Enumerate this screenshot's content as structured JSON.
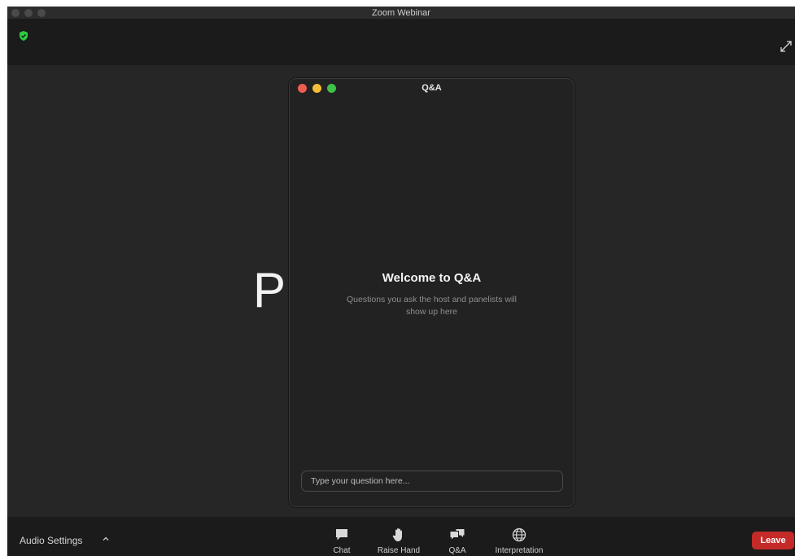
{
  "window": {
    "title": "Zoom Webinar"
  },
  "stage": {
    "presenter_text": "Pa"
  },
  "qa": {
    "title": "Q&A",
    "welcome": "Welcome to Q&A",
    "subtitle": "Questions you ask the host and panelists will show up here",
    "input": {
      "value": "",
      "placeholder": "Type your question here..."
    }
  },
  "toolbar": {
    "audio_settings": "Audio Settings",
    "buttons": {
      "chat": "Chat",
      "raise_hand": "Raise Hand",
      "qa": "Q&A",
      "interpretation": "Interpretation"
    },
    "leave": "Leave"
  },
  "icons": {
    "shield": "shield-icon",
    "expand": "expand-icon",
    "chat": "chat-icon",
    "hand": "hand-icon",
    "qa": "qa-icon",
    "globe": "globe-icon",
    "caret": "chevron-up-icon"
  },
  "colors": {
    "shield": "#2ecc40",
    "leave": "#c42a28",
    "close": "#ee5d53",
    "minimize": "#f2be38",
    "zoom": "#3fc24a"
  }
}
